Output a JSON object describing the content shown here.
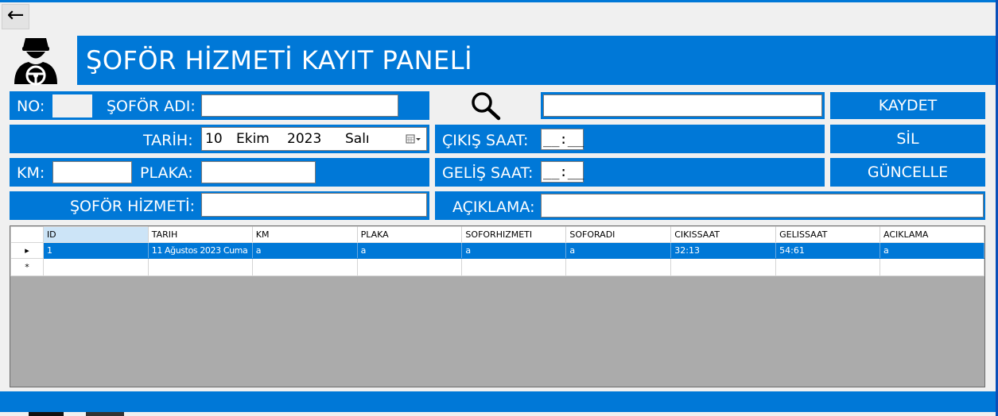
{
  "window": {
    "back_symbol": "←",
    "title": "ŞOFÖR HİZMETİ KAYIT PANELİ",
    "accent_color": "#0078d7"
  },
  "form": {
    "no_label": "NO:",
    "no_value": "",
    "driver_name_label": "ŞOFÖR ADI:",
    "driver_name_value": "",
    "date_label": "TARİH:",
    "date_day": "10",
    "date_month": "Ekim",
    "date_year": "2023",
    "date_weekday": "Salı",
    "km_label": "KM:",
    "km_value": "",
    "plate_label": "PLAKA:",
    "plate_value": "",
    "service_label": "ŞOFÖR HİZMETİ:",
    "service_value": "",
    "departure_label": "ÇIKIŞ SAAT:",
    "departure_value": "__:__",
    "arrival_label": "GELİŞ SAAT:",
    "arrival_value": "__:__",
    "description_label": "AÇIKLAMA:",
    "description_value": "",
    "search_value": ""
  },
  "buttons": {
    "save": "KAYDET",
    "delete": "SİL",
    "update": "GÜNCELLE"
  },
  "grid": {
    "columns": [
      "ID",
      "TARIH",
      "KM",
      "PLAKA",
      "SOFORHIZMETI",
      "SOFORADI",
      "CIKISSAAT",
      "GELISSAAT",
      "ACIKLAMA"
    ],
    "rows": [
      [
        "1",
        "11 Ağustos 2023 Cuma",
        "a",
        "a",
        "a",
        "a",
        "32:13",
        "54:61",
        "a"
      ]
    ],
    "current_row_marker": "▸",
    "new_row_marker": "*"
  }
}
